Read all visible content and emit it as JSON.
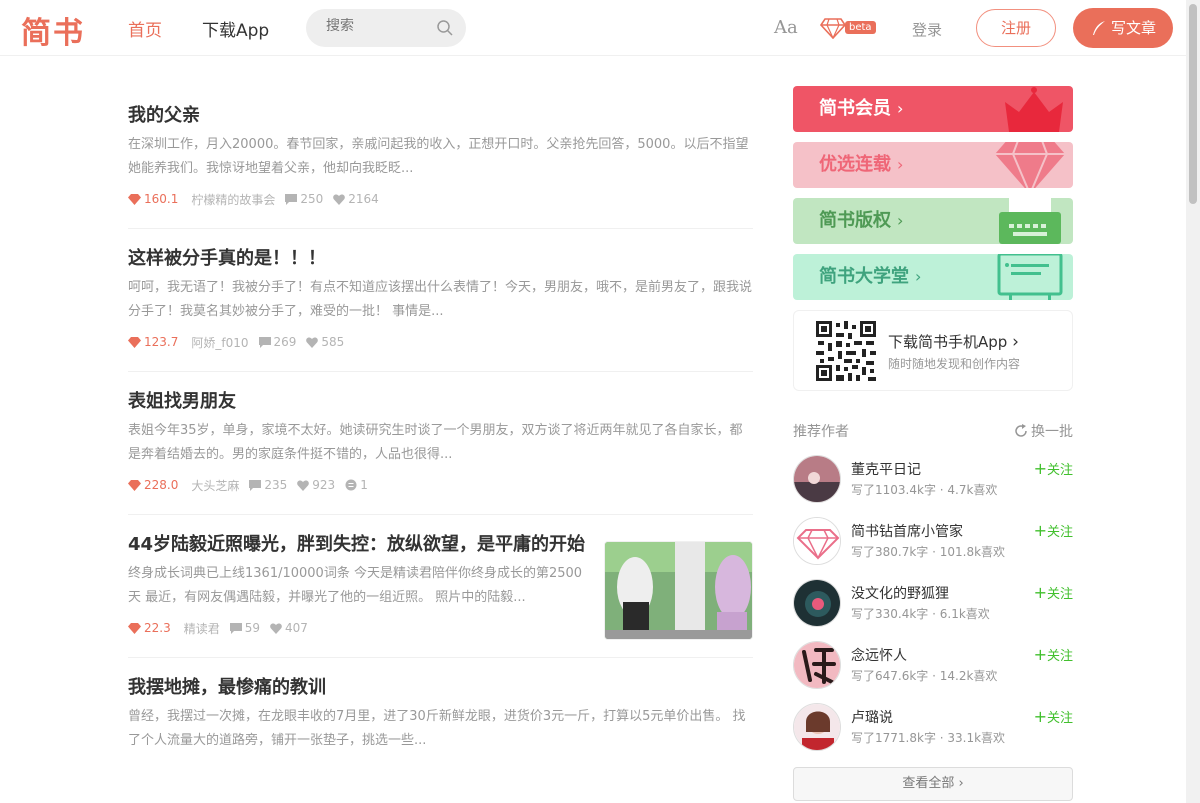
{
  "header": {
    "logo": "简书",
    "nav_home": "首页",
    "nav_app": "下载App",
    "search_placeholder": "搜索",
    "font_toggle": "Aa",
    "beta": "beta",
    "login": "登录",
    "signup": "注册",
    "write": "写文章"
  },
  "articles": [
    {
      "title": "我的父亲",
      "abstract": "在深圳工作，月入20000。春节回家，亲戚问起我的收入，正想开口时。父亲抢先回答，5000。以后不指望她能养我们。我惊讶地望着父亲，他却向我眨眨...",
      "diamonds": "160.1",
      "author": "柠檬精的故事会",
      "comments": "250",
      "likes": "2164"
    },
    {
      "title": "这样被分手真的是！！！",
      "abstract": "呵呵，我无语了！我被分手了！有点不知道应该摆出什么表情了！今天，男朋友，哦不，是前男友了，跟我说分手了！我莫名其妙被分手了，难受的一批！ 事情是...",
      "diamonds": "123.7",
      "author": "阿娇_f010",
      "comments": "269",
      "likes": "585"
    },
    {
      "title": "表姐找男朋友",
      "abstract": "表姐今年35岁，单身，家境不太好。她读研究生时谈了一个男朋友，双方谈了将近两年就见了各自家长，都是奔着结婚去的。男的家庭条件挺不错的，人品也很得...",
      "diamonds": "228.0",
      "author": "大头芝麻",
      "comments": "235",
      "likes": "923",
      "rewards": "1"
    },
    {
      "title": "44岁陆毅近照曝光，胖到失控：放纵欲望，是平庸的开始",
      "abstract": "终身成长词典已上线1361/10000词条 今天是精读君陪伴你终身成长的第2500天 最近，有网友偶遇陆毅，并曝光了他的一组近照。 照片中的陆毅...",
      "diamonds": "22.3",
      "author": "精读君",
      "comments": "59",
      "likes": "407"
    },
    {
      "title": "我摆地摊，最惨痛的教训",
      "abstract": "曾经，我摆过一次摊，在龙眼丰收的7月里，进了30斤新鲜龙眼，进货价3元一斤，打算以5元单价出售。 找了个人流量大的道路旁，铺开一张垫子，挑选一些..."
    }
  ],
  "sidebar": {
    "banners": [
      "简书会员",
      "优选连载",
      "简书版权",
      "简书大学堂"
    ],
    "banner_arrow": "›",
    "app_title": "下载简书手机App",
    "app_arrow": "›",
    "app_sub": "随时随地发现和创作内容",
    "rec_title": "推荐作者",
    "change": "换一批",
    "follow_plus": "+",
    "follow_label": "关注",
    "authors": [
      {
        "name": "董克平日记",
        "info": "写了1103.4k字 · 4.7k喜欢"
      },
      {
        "name": "简书钻首席小管家",
        "info": "写了380.7k字 · 101.8k喜欢"
      },
      {
        "name": "没文化的野狐狸",
        "info": "写了330.4k字 · 6.1k喜欢"
      },
      {
        "name": "念远怀人",
        "info": "写了647.6k字 · 14.2k喜欢"
      },
      {
        "name": "卢璐说",
        "info": "写了1771.8k字 · 33.1k喜欢"
      }
    ],
    "see_all": "查看全部",
    "see_all_arrow": "›"
  },
  "colors": {
    "brand": "#ea6f5a",
    "follow": "#42c02e"
  }
}
